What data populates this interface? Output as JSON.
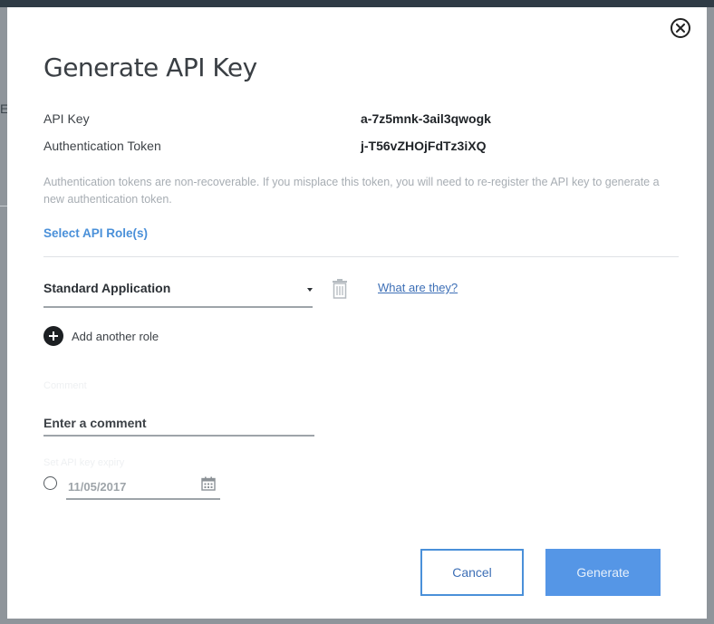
{
  "backdrop": {
    "left_fragment": "E"
  },
  "modal": {
    "title": "Generate API Key",
    "api_key_label": "API Key",
    "api_key_value": "a-7z5mnk-3ail3qwogk",
    "auth_token_label": "Authentication Token",
    "auth_token_value": "j-T56vZHOjFdTz3iXQ",
    "info_text": "Authentication tokens are non-recoverable. If you misplace this token, you will need to re-register the API key to generate a new authentication token.",
    "select_roles_label": "Select API Role(s)",
    "role_select_value": "Standard Application",
    "help_link": "What are they?",
    "add_role_label": "Add another role",
    "comment_label": "Comment",
    "comment_placeholder": "Enter a comment",
    "expiry_label": "Set API key expiry",
    "expiry_date": "11/05/2017",
    "cancel_label": "Cancel",
    "generate_label": "Generate"
  },
  "icons": {
    "close": "close-icon",
    "caret": "chevron-down-icon",
    "trash": "trash-icon",
    "add": "plus-circle-icon",
    "calendar": "calendar-icon"
  },
  "colors": {
    "accent": "#4a90d9",
    "primary_button": "#5596e6",
    "overlay": "#8f959b"
  }
}
